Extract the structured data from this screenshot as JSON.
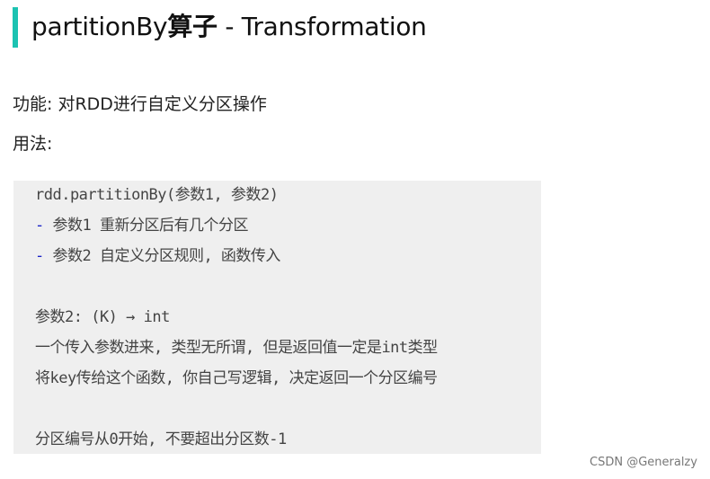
{
  "heading": {
    "title_prefix": "partitionBy",
    "title_bold": "算子",
    "title_suffix": " - Transformation",
    "accent_color": "#1cc3b2"
  },
  "body": {
    "function_line": "功能: 对RDD进行自定义分区操作",
    "usage_label": "用法:"
  },
  "code": {
    "lines": [
      {
        "dash": "",
        "text": "rdd.partitionBy(参数1, 参数2)"
      },
      {
        "dash": "-",
        "text": " 参数1 重新分区后有几个分区"
      },
      {
        "dash": "-",
        "text": " 参数2 自定义分区规则, 函数传入"
      },
      {
        "dash": "",
        "text": ""
      },
      {
        "dash": "",
        "text": "参数2: (K) → int"
      },
      {
        "dash": "",
        "text": "一个传入参数进来, 类型无所谓, 但是返回值一定是int类型"
      },
      {
        "dash": "",
        "text": "将key传给这个函数, 你自己写逻辑, 决定返回一个分区编号"
      },
      {
        "dash": "",
        "text": ""
      },
      {
        "dash": "",
        "text": "分区编号从0开始, 不要超出分区数-1"
      }
    ]
  },
  "watermark": "CSDN @Generalzy"
}
